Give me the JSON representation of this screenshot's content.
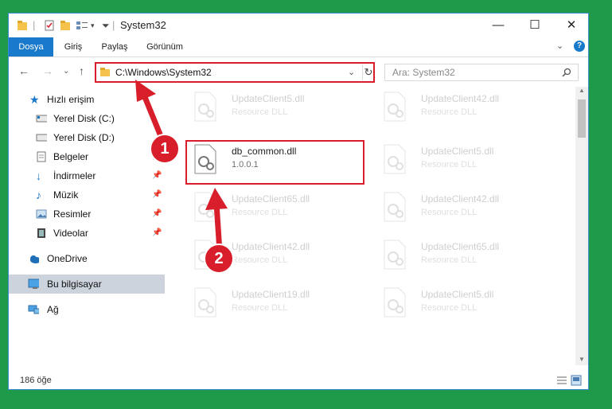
{
  "window": {
    "title": "System32"
  },
  "ribbon": {
    "tabs": [
      "Dosya",
      "Giriş",
      "Paylaş",
      "Görünüm"
    ]
  },
  "address": {
    "path": "C:\\Windows\\System32"
  },
  "search": {
    "placeholder": "Ara: System32"
  },
  "sidebar": {
    "items": [
      {
        "label": "Hızlı erişim"
      },
      {
        "label": "Yerel Disk (C:)"
      },
      {
        "label": "Yerel Disk (D:)"
      },
      {
        "label": "Belgeler"
      },
      {
        "label": "İndirmeler"
      },
      {
        "label": "Müzik"
      },
      {
        "label": "Resimler"
      },
      {
        "label": "Videolar"
      },
      {
        "label": "OneDrive"
      },
      {
        "label": "Bu bilgisayar"
      },
      {
        "label": "Ağ"
      }
    ]
  },
  "files": [
    {
      "name": "UpdateClient5.dll",
      "type": "Resource DLL"
    },
    {
      "name": "UpdateClient42.dll",
      "type": "Resource DLL"
    },
    {
      "name": "db_common.dll",
      "type": "1.0.0.1"
    },
    {
      "name": "UpdateClient5.dll",
      "type": "Resource DLL"
    },
    {
      "name": "UpdateClient65.dll",
      "type": "Resource DLL"
    },
    {
      "name": "UpdateClient42.dll",
      "type": "Resource DLL"
    },
    {
      "name": "UpdateClient42.dll",
      "type": "Resource DLL"
    },
    {
      "name": "UpdateClient65.dll",
      "type": "Resource DLL"
    },
    {
      "name": "UpdateClient19.dll",
      "type": "Resource DLL"
    },
    {
      "name": "UpdateClient5.dll",
      "type": "Resource DLL"
    }
  ],
  "status": {
    "count": "186 öğe"
  },
  "callouts": [
    "1",
    "2"
  ],
  "colors": {
    "highlight": "#d81e2a",
    "accent": "#1979ca",
    "background": "#1e9a4a"
  }
}
